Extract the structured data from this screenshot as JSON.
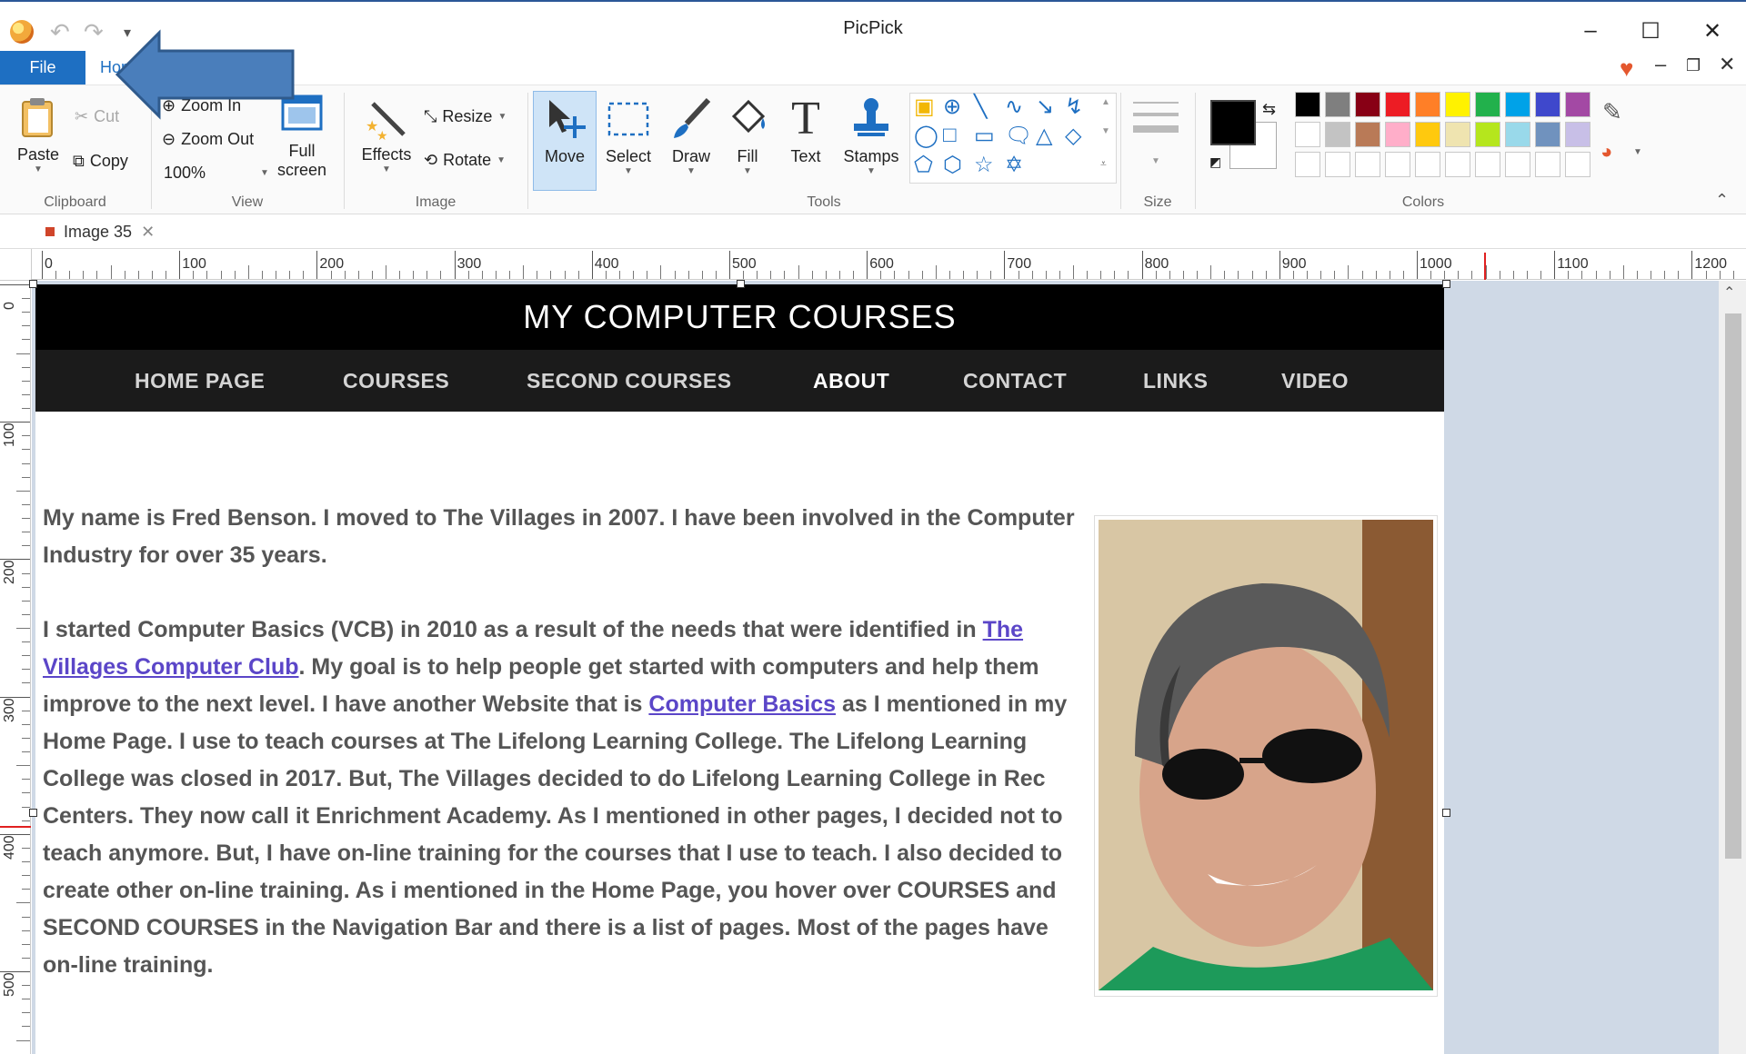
{
  "window": {
    "title": "PicPick",
    "minimize": "–",
    "maximize": "☐",
    "close": "✕"
  },
  "menu": {
    "file": "File",
    "home": "Home"
  },
  "ribbon": {
    "clipboard": {
      "label": "Clipboard",
      "paste": "Paste",
      "cut": "Cut",
      "copy": "Copy"
    },
    "view": {
      "label": "View",
      "zoom_in": "Zoom In",
      "zoom_out": "Zoom Out",
      "zoom_level": "100%",
      "full_screen_line1": "Full",
      "full_screen_line2": "screen"
    },
    "image": {
      "label": "Image",
      "effects": "Effects",
      "resize": "Resize",
      "rotate": "Rotate"
    },
    "tools": {
      "label": "Tools",
      "move": "Move",
      "select": "Select",
      "draw": "Draw",
      "fill": "Fill",
      "text": "Text",
      "stamps": "Stamps"
    },
    "size": {
      "label": "Size"
    },
    "colors": {
      "label": "Colors",
      "primary": "#000000",
      "secondary": "#ffffff",
      "palette_row1": [
        "#000000",
        "#7f7f7f",
        "#880015",
        "#ed1c24",
        "#ff7f27",
        "#fff200",
        "#22b14c",
        "#00a2e8",
        "#3f48cc",
        "#a349a4"
      ],
      "palette_row2": [
        "#ffffff",
        "#c3c3c3",
        "#b97a57",
        "#ffaec9",
        "#ffc90e",
        "#efe4b0",
        "#b5e61d",
        "#99d9ea",
        "#7092be",
        "#c8bfe7"
      ]
    }
  },
  "document_tab": {
    "name": "Image 35"
  },
  "ruler": {
    "horizontal": [
      "0",
      "100",
      "200",
      "300",
      "400",
      "500",
      "600",
      "700",
      "800",
      "900",
      "1000",
      "1100",
      "1200"
    ],
    "vertical": [
      "0",
      "100",
      "200",
      "300",
      "400",
      "500"
    ]
  },
  "site": {
    "title": "MY COMPUTER COURSES",
    "nav": [
      "HOME PAGE",
      "COURSES",
      "SECOND COURSES",
      "ABOUT",
      "CONTACT",
      "LINKS",
      "VIDEO"
    ],
    "active_nav": "ABOUT",
    "para1": "My name is Fred Benson.  I moved to The Villages in 2007.  I have been involved in the Computer Industry for over 35 years.",
    "para2_a": "I started Computer Basics (VCB) in 2010 as a result of the needs that were identified in ",
    "link1": "The Villages Computer Club",
    "para2_b": ".  My goal is to help people get started with computers and help them improve to the next level.  I have another Website that is ",
    "link2": "Computer Basics",
    "para2_c": " as I mentioned in my Home Page.  I use to teach courses at The Lifelong Learning College.  The Lifelong Learning College was closed in 2017.  But, The Villages decided to do Lifelong Learning College in Rec Centers.  They now call it Enrichment Academy.  As I mentioned in other pages, I decided not to teach anymore.  But, I have on-line training for the courses that I use to teach.  I also decided to create other on-line training.  As i mentioned in the Home Page, you hover over COURSES and SECOND COURSES in the Navigation Bar and there is a list of pages.  Most of the pages have on-line training."
  }
}
